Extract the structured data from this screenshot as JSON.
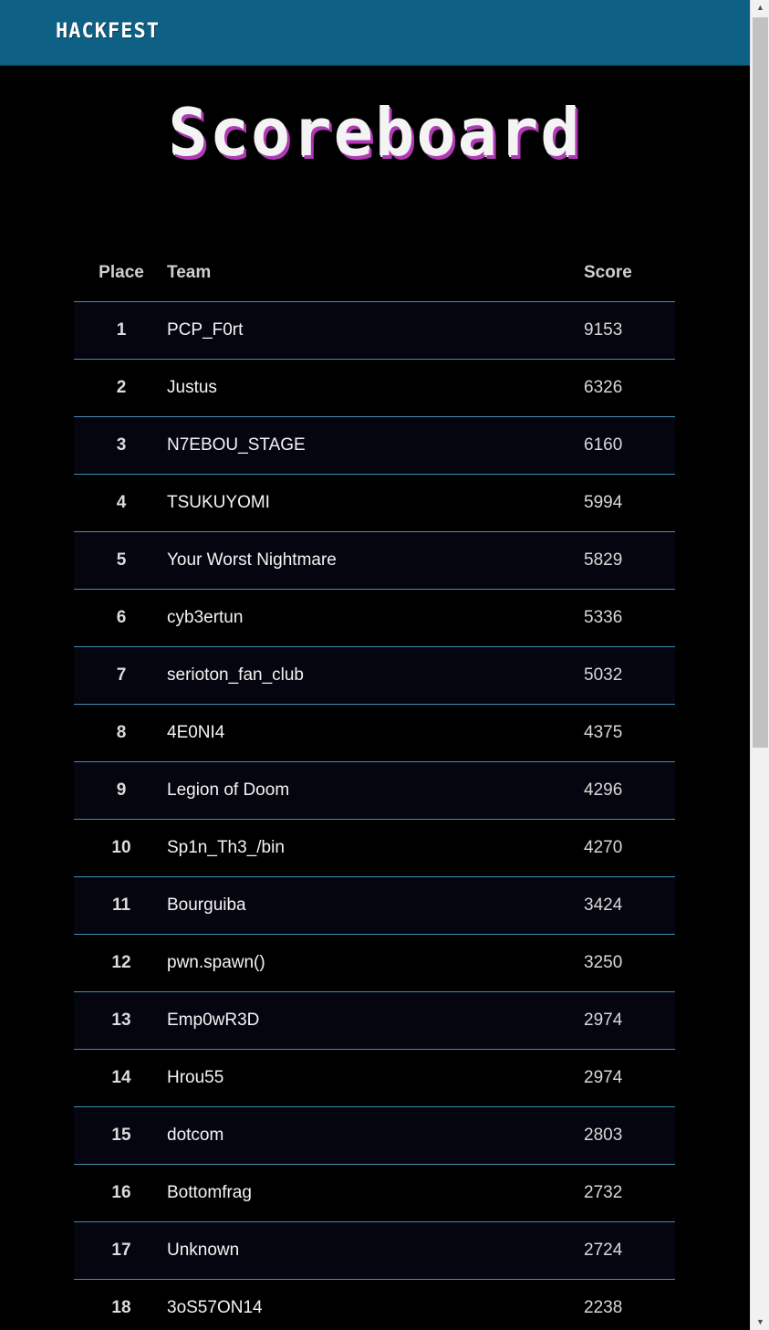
{
  "navbar": {
    "brand": "HACKFEST",
    "background_color": "#0e6084"
  },
  "page": {
    "title": "Scoreboard"
  },
  "table": {
    "headers": {
      "place": "Place",
      "team": "Team",
      "score": "Score"
    },
    "rows": [
      {
        "place": "1",
        "team": "PCP_F0rt",
        "score": "9153"
      },
      {
        "place": "2",
        "team": "Justus",
        "score": "6326"
      },
      {
        "place": "3",
        "team": "N7EBOU_STAGE",
        "score": "6160"
      },
      {
        "place": "4",
        "team": "TSUKUYOMI",
        "score": "5994"
      },
      {
        "place": "5",
        "team": "Your Worst Nightmare",
        "score": "5829"
      },
      {
        "place": "6",
        "team": "cyb3ertun",
        "score": "5336"
      },
      {
        "place": "7",
        "team": "serioton_fan_club",
        "score": "5032"
      },
      {
        "place": "8",
        "team": "4E0NI4",
        "score": "4375"
      },
      {
        "place": "9",
        "team": "Legion of Doom",
        "score": "4296"
      },
      {
        "place": "10",
        "team": "Sp1n_Th3_/bin",
        "score": "4270"
      },
      {
        "place": "11",
        "team": "Bourguiba",
        "score": "3424"
      },
      {
        "place": "12",
        "team": "pwn.spawn()",
        "score": "3250"
      },
      {
        "place": "13",
        "team": "Emp0wR3D",
        "score": "2974"
      },
      {
        "place": "14",
        "team": "Hrou55",
        "score": "2974"
      },
      {
        "place": "15",
        "team": "dotcom",
        "score": "2803"
      },
      {
        "place": "16",
        "team": "Bottomfrag",
        "score": "2732"
      },
      {
        "place": "17",
        "team": "Unknown",
        "score": "2724"
      },
      {
        "place": "18",
        "team": "3oS57ON14",
        "score": "2238"
      }
    ]
  },
  "scrollbar": {
    "up_icon": "triangle-up",
    "down_icon": "triangle-down"
  }
}
